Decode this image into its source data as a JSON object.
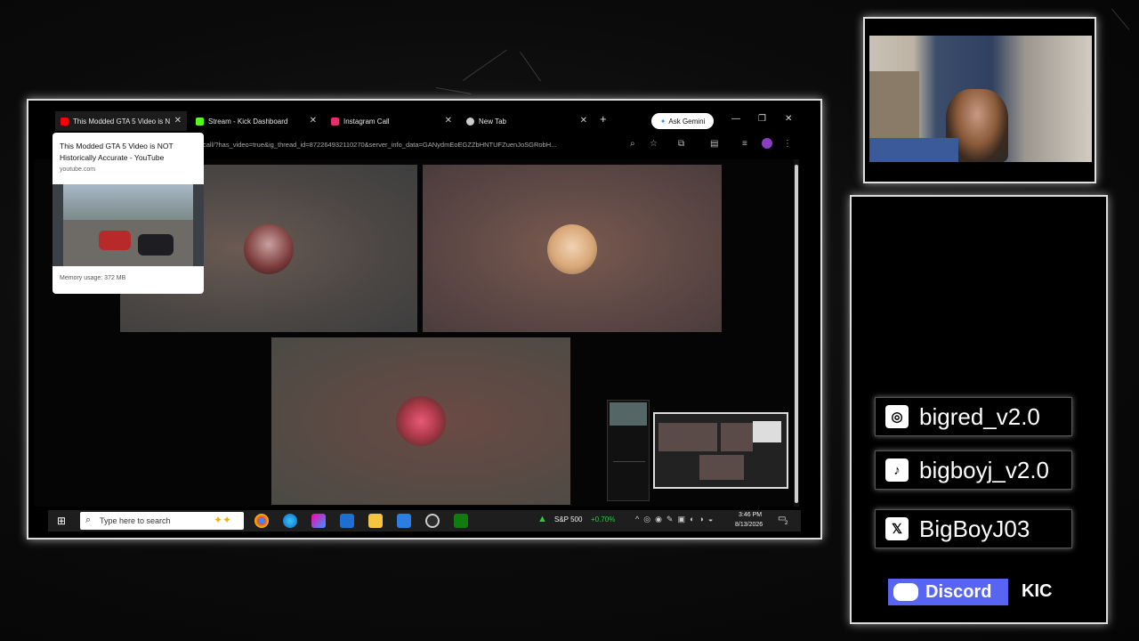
{
  "browser": {
    "tabs": [
      {
        "label": "This Modded GTA 5 Video is N",
        "favicon": "youtube-icon",
        "color": "#ff0000"
      },
      {
        "label": "Stream - Kick Dashboard",
        "favicon": "kick-icon",
        "color": "#53fc18"
      },
      {
        "label": "Instagram Call",
        "favicon": "instagram-icon",
        "color": "#e1306c"
      },
      {
        "label": "New Tab",
        "favicon": "chrome-icon",
        "color": "#cccccc"
      }
    ],
    "ask_gemini_label": "Ask Gemini",
    "url": "call/?has_video=true&ig_thread_id=872264932110270&server_info_data=GANydmEoEGZZbHNTUFZuenJoSGRobH..."
  },
  "tab_preview": {
    "title": "This Modded GTA 5 Video is NOT Historically Accurate - YouTube",
    "domain": "youtube.com",
    "memory": "Memory usage: 372 MB"
  },
  "taskbar": {
    "search_placeholder": "Type here to search",
    "stock_name": "S&P 500",
    "stock_change": "+0.70%",
    "time": "3:46 PM",
    "date": "8/13/2026",
    "notif_count": "2"
  },
  "socials": [
    {
      "icon": "instagram-icon",
      "handle": "bigred_v2.0"
    },
    {
      "icon": "tiktok-icon",
      "handle": "bigboyj_v2.0"
    },
    {
      "icon": "x-icon",
      "handle": "BigBoyJ03"
    }
  ],
  "discord_label": "Discord",
  "kick_label": "KIC"
}
